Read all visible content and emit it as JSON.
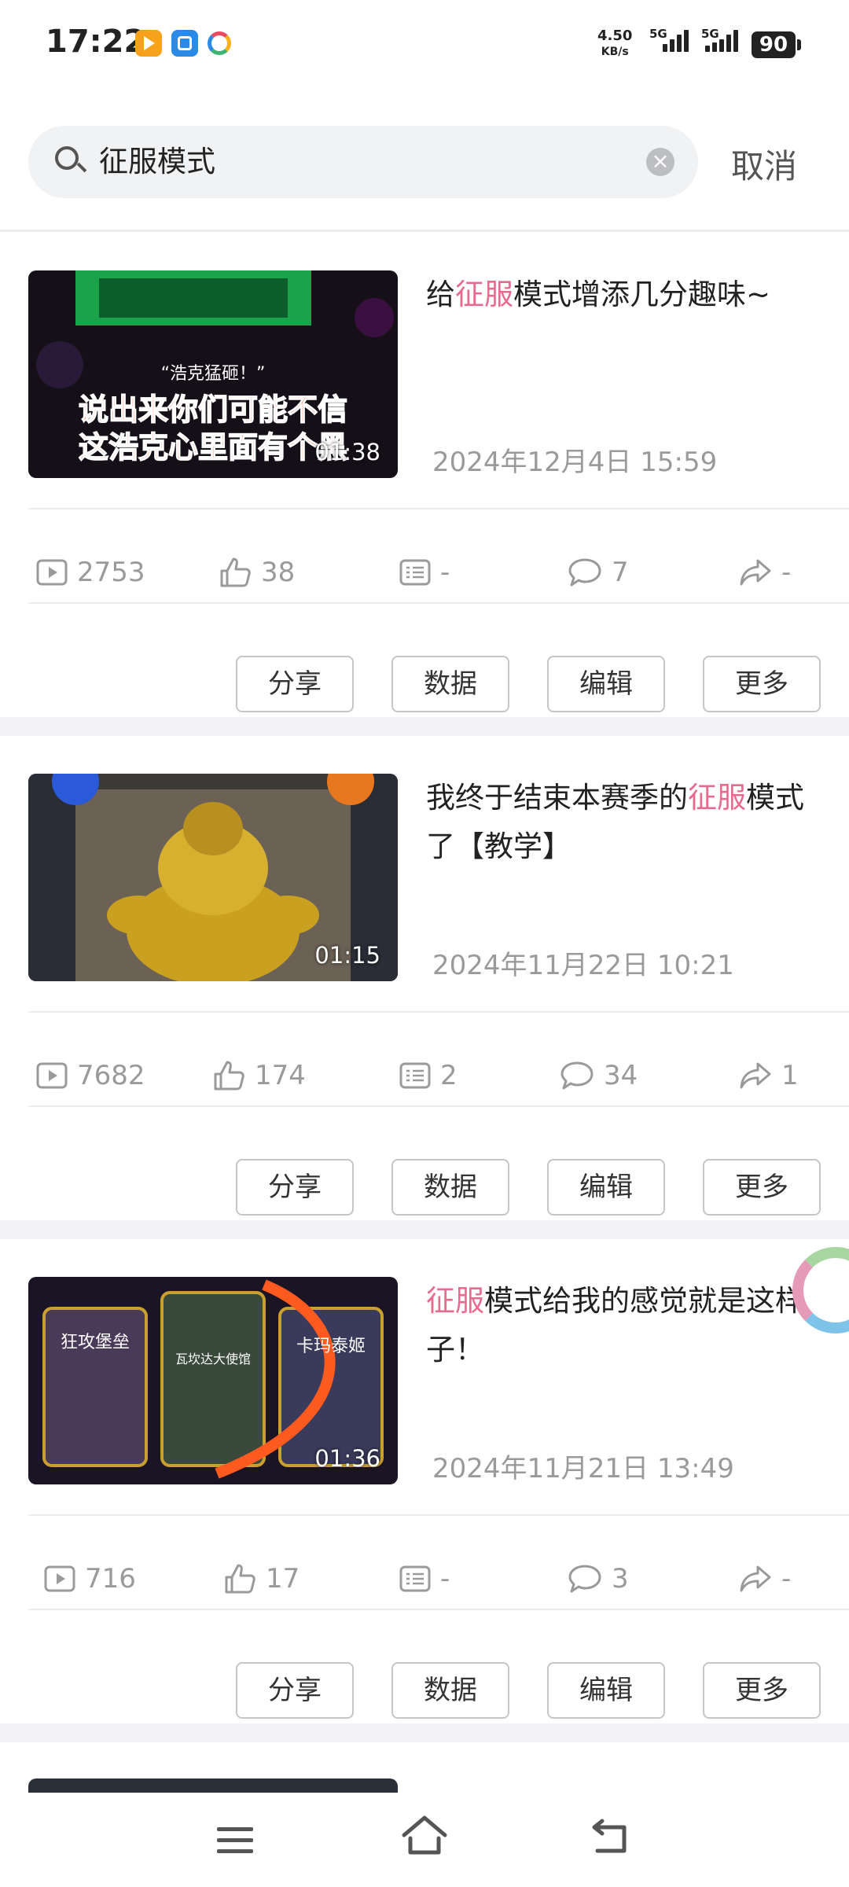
{
  "status_bar": {
    "time": "17:22",
    "net_speed_value": "4.50",
    "net_speed_unit": "KB/s",
    "signal_1": "5G",
    "signal_2": "5G",
    "battery": "90"
  },
  "search": {
    "query": "征服模式",
    "cancel_label": "取消"
  },
  "colors": {
    "highlight": "#e86a8e",
    "meta_text": "#9a9a9a"
  },
  "videos": [
    {
      "title_pre": "给",
      "title_hl": "征服",
      "title_post": "模式增添几分趣味~",
      "date": "2024年12月4日 15:59",
      "duration": "01:38",
      "thumb_text_1": "“浩克猛砸！”",
      "thumb_text_2": "说出来你们可能不信",
      "thumb_text_3": "这浩克心里面有个黑",
      "stats": {
        "views": "2753",
        "likes": "38",
        "danmaku": "-",
        "comments": "7",
        "shares": "-"
      }
    },
    {
      "title_pre": "我终于结束本赛季的",
      "title_hl": "征服",
      "title_post": "模式了【教学】",
      "date": "2024年11月22日 10:21",
      "duration": "01:15",
      "stats": {
        "views": "7682",
        "likes": "174",
        "danmaku": "2",
        "comments": "34",
        "shares": "1"
      }
    },
    {
      "title_pre": "",
      "title_hl": "征服",
      "title_post": "模式给我的感觉就是这样子！",
      "date": "2024年11月21日 13:49",
      "duration": "01:36",
      "thumb_text_1": "狂攻堡垒",
      "thumb_text_2": "瓦坎达大使馆",
      "thumb_text_3": "卡玛泰姬",
      "stats": {
        "views": "716",
        "likes": "17",
        "danmaku": "-",
        "comments": "3",
        "shares": "-"
      }
    }
  ],
  "actions": {
    "share": "分享",
    "data": "数据",
    "edit": "编辑",
    "more": "更多"
  }
}
